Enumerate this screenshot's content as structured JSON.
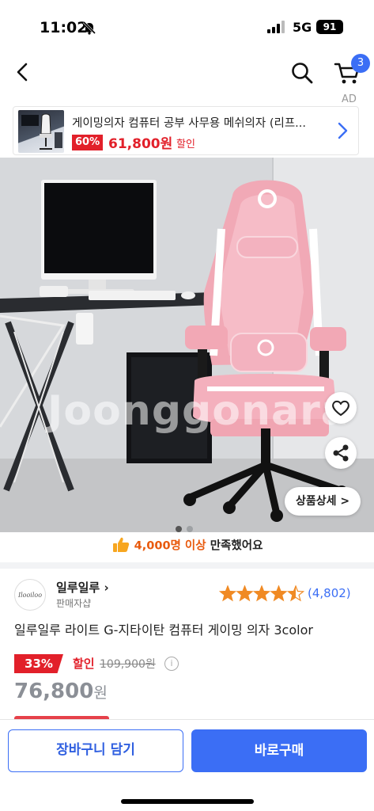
{
  "status_bar": {
    "time": "11:02",
    "network": "5G",
    "battery": "91"
  },
  "nav": {
    "back_icon": "chevron-left-icon",
    "search_icon": "search-icon",
    "cart_icon": "cart-icon",
    "cart_badge": "3"
  },
  "ad": {
    "label": "AD",
    "title": "게이밍의자 컴퓨터 공부 사무용 메쉬의자 (리프...",
    "discount": "60%",
    "price": "61,800원",
    "price_tag": "할인"
  },
  "product_image": {
    "watermark": "Joonggonara",
    "detail_button": "상품상세 >",
    "like_icon": "heart-icon",
    "share_icon": "share-icon",
    "page_total": 2,
    "page_current": 1
  },
  "satisfaction": {
    "icon": "thumbs-up-icon",
    "count": "4,000명 이상",
    "text": "만족했어요"
  },
  "seller": {
    "logo_text": "Ilooiloo",
    "name": "일루일루",
    "type": "판매자샵"
  },
  "rating": {
    "stars": 4.5,
    "count": "(4,802)"
  },
  "product": {
    "title": "일루일루 라이트 G-지타이탄 컴퓨터 게이밍 의자 3color"
  },
  "price": {
    "discount_badge": "33%",
    "discount_label": "할인",
    "original": "109,900원",
    "sale": "76,800",
    "sale_unit": "원"
  },
  "bottom_bar": {
    "cart_button": "장바구니 담기",
    "buy_button": "바로구매"
  },
  "colors": {
    "accent": "#3b6ef5",
    "sale_red": "#e2202a",
    "satisfaction_orange": "#e8590c",
    "star": "#f08a24"
  }
}
